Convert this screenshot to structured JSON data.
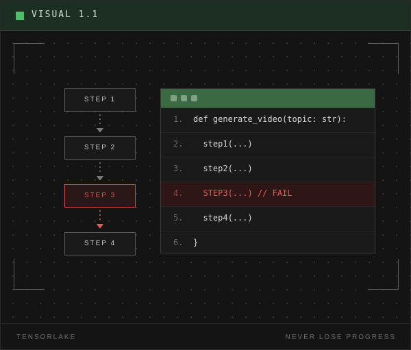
{
  "header": {
    "title": "VISUAL 1.1",
    "accent": "#4fbe6a"
  },
  "steps": [
    {
      "label": "STEP 1",
      "status": "ok"
    },
    {
      "label": "STEP 2",
      "status": "ok"
    },
    {
      "label": "STEP 3",
      "status": "fail"
    },
    {
      "label": "STEP 4",
      "status": "ok"
    }
  ],
  "code": {
    "lines": [
      {
        "num": "1.",
        "text": "def generate_video(topic: str):",
        "status": "normal"
      },
      {
        "num": "2.",
        "text": "  step1(...)",
        "status": "normal"
      },
      {
        "num": "3.",
        "text": "  step2(...)",
        "status": "normal"
      },
      {
        "num": "4.",
        "text": "  STEP3(...) // FAIL",
        "status": "fail"
      },
      {
        "num": "5.",
        "text": "  step4(...)",
        "status": "normal"
      },
      {
        "num": "6.",
        "text": "}",
        "status": "normal"
      }
    ]
  },
  "footer": {
    "left": "TENSORLAKE",
    "right": "NEVER LOSE PROGRESS"
  },
  "colors": {
    "fail": "#e15c5c",
    "connector": "#7a7a7a",
    "connector_fail": "#e15c5c"
  }
}
